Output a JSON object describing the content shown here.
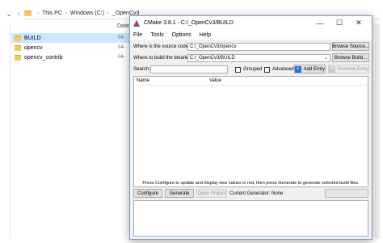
{
  "explorer": {
    "breadcrumb": [
      "This PC",
      "Windows (C:)",
      "_OpenCv3"
    ],
    "column_header": "Date",
    "files": [
      {
        "name": "BUILD",
        "date": "04-",
        "selected": true
      },
      {
        "name": "opencv",
        "date": "04-",
        "selected": false
      },
      {
        "name": "opencv_contrib",
        "date": "04-",
        "selected": false
      }
    ]
  },
  "cmake": {
    "title": "CMake 3.8.1 - C:/_OpenCv3/BUILD",
    "menu": [
      "File",
      "Tools",
      "Options",
      "Help"
    ],
    "source_label": "Where is the source code:",
    "source_value": "C:/_OpenCv3/opencv",
    "browse_source": "Browse Source...",
    "build_label": "Where to build the binaries:",
    "build_value": "C:/_OpenCv3/BUILD",
    "browse_build": "Browse Build...",
    "search_label": "Search:",
    "search_value": "",
    "grouped_label": "Grouped",
    "advanced_label": "Advanced",
    "add_entry": "Add Entry",
    "remove_entry": "Remove Entry",
    "col_name": "Name",
    "col_value": "Value",
    "status": "Press Configure to update and display new values in red, then press Generate to generate selected build files.",
    "configure": "Configure",
    "generate": "Generate",
    "open_project": "Open Project",
    "current_generator": "Current Generator: None",
    "colors": {
      "accent": "#2a6fd6",
      "selection": "#cce8ff",
      "folder": "#f3c95b"
    }
  }
}
